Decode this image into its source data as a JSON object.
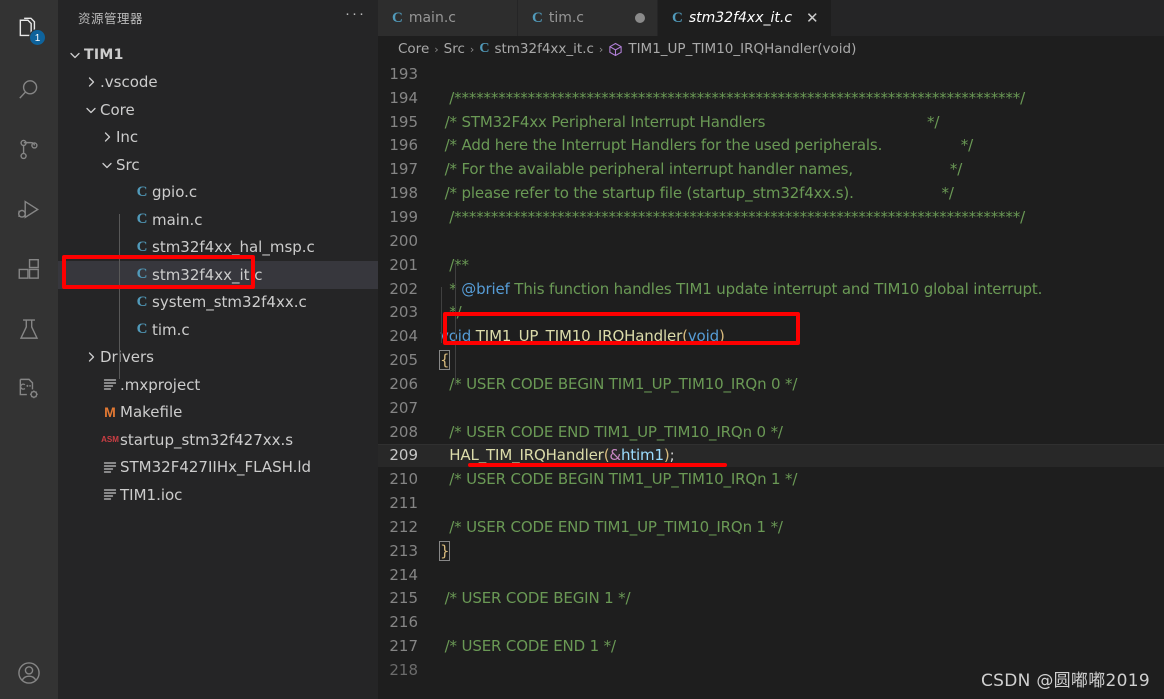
{
  "activity_bar": {
    "items": [
      {
        "name": "explorer",
        "icon": "files-icon",
        "active": true,
        "badge": "1"
      },
      {
        "name": "search",
        "icon": "search-icon",
        "active": false,
        "badge": ""
      },
      {
        "name": "source-control",
        "icon": "source-control-icon",
        "active": false,
        "badge": ""
      },
      {
        "name": "run-and-debug",
        "icon": "run-debug-icon",
        "active": false,
        "badge": ""
      },
      {
        "name": "extensions",
        "icon": "extensions-icon",
        "active": false,
        "badge": ""
      },
      {
        "name": "testing",
        "icon": "flask-icon",
        "active": false,
        "badge": ""
      },
      {
        "name": "cpp-config",
        "icon": "cpp-gear-icon",
        "active": false,
        "badge": ""
      }
    ],
    "bottom": [
      {
        "name": "accounts",
        "icon": "account-icon"
      }
    ]
  },
  "sidebar": {
    "title": "资源管理器",
    "more_actions": "···",
    "tree": [
      {
        "label": "TIM1",
        "depth": 0,
        "kind": "folder-root",
        "twisty": "down",
        "icon": "",
        "selected": false
      },
      {
        "label": ".vscode",
        "depth": 1,
        "kind": "folder",
        "twisty": "right",
        "icon": "",
        "selected": false
      },
      {
        "label": "Core",
        "depth": 1,
        "kind": "folder",
        "twisty": "down",
        "icon": "",
        "selected": false
      },
      {
        "label": "Inc",
        "depth": 2,
        "kind": "folder",
        "twisty": "right",
        "icon": "",
        "selected": false
      },
      {
        "label": "Src",
        "depth": 2,
        "kind": "folder",
        "twisty": "down",
        "icon": "",
        "selected": false
      },
      {
        "label": "gpio.c",
        "depth": 3,
        "kind": "file",
        "twisty": "none",
        "icon": "c-file-icon",
        "selected": false
      },
      {
        "label": "main.c",
        "depth": 3,
        "kind": "file",
        "twisty": "none",
        "icon": "c-file-icon",
        "selected": false
      },
      {
        "label": "stm32f4xx_hal_msp.c",
        "depth": 3,
        "kind": "file",
        "twisty": "none",
        "icon": "c-file-icon",
        "selected": false
      },
      {
        "label": "stm32f4xx_it.c",
        "depth": 3,
        "kind": "file",
        "twisty": "none",
        "icon": "c-file-icon",
        "selected": true
      },
      {
        "label": "system_stm32f4xx.c",
        "depth": 3,
        "kind": "file",
        "twisty": "none",
        "icon": "c-file-icon",
        "selected": false
      },
      {
        "label": "tim.c",
        "depth": 3,
        "kind": "file",
        "twisty": "none",
        "icon": "c-file-icon",
        "selected": false
      },
      {
        "label": "Drivers",
        "depth": 1,
        "kind": "folder",
        "twisty": "right",
        "icon": "",
        "selected": false
      },
      {
        "label": ".mxproject",
        "depth": 1,
        "kind": "file",
        "twisty": "none",
        "icon": "text-file-icon",
        "selected": false
      },
      {
        "label": "Makefile",
        "depth": 1,
        "kind": "file",
        "twisty": "none",
        "icon": "makefile-icon",
        "selected": false
      },
      {
        "label": "startup_stm32f427xx.s",
        "depth": 1,
        "kind": "file",
        "twisty": "none",
        "icon": "asm-file-icon",
        "selected": false
      },
      {
        "label": "STM32F427IIHx_FLASH.ld",
        "depth": 1,
        "kind": "file",
        "twisty": "none",
        "icon": "text-file-icon",
        "selected": false
      },
      {
        "label": "TIM1.ioc",
        "depth": 1,
        "kind": "file",
        "twisty": "none",
        "icon": "text-file-icon",
        "selected": false
      }
    ]
  },
  "tabs": [
    {
      "label": "main.c",
      "icon": "c-file-icon",
      "active": false,
      "dirty": false,
      "closable": false
    },
    {
      "label": "tim.c",
      "icon": "c-file-icon",
      "active": false,
      "dirty": true,
      "closable": false
    },
    {
      "label": "stm32f4xx_it.c",
      "icon": "c-file-icon",
      "active": true,
      "dirty": false,
      "closable": true
    }
  ],
  "breadcrumb": {
    "parts": [
      "Core",
      "Src",
      "stm32f4xx_it.c",
      "TIM1_UP_TIM10_IRQHandler(void)"
    ],
    "separator": "›",
    "file_icon": "c-file-icon",
    "symbol_icon": "symbol-method-icon"
  },
  "editor": {
    "active_line": 209,
    "first_line": 193,
    "last_line": 218,
    "lines": [
      {
        "n": 193,
        "tokens": []
      },
      {
        "n": 194,
        "tokens": [
          {
            "t": "  /*****************************************************************************/",
            "c": "cmt"
          }
        ]
      },
      {
        "n": 195,
        "tokens": [
          {
            "t": " /* STM32F4xx Peripheral Interrupt Handlers                                   */",
            "c": "cmt"
          }
        ]
      },
      {
        "n": 196,
        "tokens": [
          {
            "t": " /* Add here the Interrupt Handlers for the used peripherals.                 */",
            "c": "cmt"
          }
        ]
      },
      {
        "n": 197,
        "tokens": [
          {
            "t": " /* For the available peripheral interrupt handler names,                     */",
            "c": "cmt"
          }
        ]
      },
      {
        "n": 198,
        "tokens": [
          {
            "t": " /* please refer to the startup file (startup_stm32f4xx.s).                   */",
            "c": "cmt"
          }
        ]
      },
      {
        "n": 199,
        "tokens": [
          {
            "t": "  /*****************************************************************************/",
            "c": "cmt"
          }
        ]
      },
      {
        "n": 200,
        "tokens": []
      },
      {
        "n": 201,
        "tokens": [
          {
            "t": "  /**",
            "c": "cmt"
          }
        ]
      },
      {
        "n": 202,
        "tokens": [
          {
            "t": "  * ",
            "c": "cmt"
          },
          {
            "t": "@brief",
            "c": "doctag"
          },
          {
            "t": " This function handles TIM1 update interrupt and TIM10 global interrupt.",
            "c": "cmt"
          }
        ]
      },
      {
        "n": 203,
        "tokens": [
          {
            "t": "  */",
            "c": "cmt"
          }
        ]
      },
      {
        "n": 204,
        "tokens": [
          {
            "t": "void",
            "c": "kw"
          },
          {
            "t": " ",
            "c": "punc"
          },
          {
            "t": "TIM1_UP_TIM10_IRQHandler",
            "c": "fn"
          },
          {
            "t": "(",
            "c": "par"
          },
          {
            "t": "void",
            "c": "kw"
          },
          {
            "t": ")",
            "c": "par"
          }
        ]
      },
      {
        "n": 205,
        "tokens": [
          {
            "t": "{",
            "c": "brace-hl"
          }
        ]
      },
      {
        "n": 206,
        "tokens": [
          {
            "t": "  /* USER CODE BEGIN TIM1_UP_TIM10_IRQn 0 */",
            "c": "cmt"
          }
        ]
      },
      {
        "n": 207,
        "tokens": []
      },
      {
        "n": 208,
        "tokens": [
          {
            "t": "  /* USER CODE END TIM1_UP_TIM10_IRQn 0 */",
            "c": "cmt"
          }
        ]
      },
      {
        "n": 209,
        "tokens": [
          {
            "t": "  ",
            "c": "punc"
          },
          {
            "t": "HAL_TIM_IRQHandler",
            "c": "fn"
          },
          {
            "t": "(",
            "c": "par"
          },
          {
            "t": "&",
            "c": "op"
          },
          {
            "t": "htim1",
            "c": "var"
          },
          {
            "t": ")",
            "c": "par"
          },
          {
            "t": ";",
            "c": "punc"
          }
        ]
      },
      {
        "n": 210,
        "tokens": [
          {
            "t": "  /* USER CODE BEGIN TIM1_UP_TIM10_IRQn 1 */",
            "c": "cmt"
          }
        ]
      },
      {
        "n": 211,
        "tokens": []
      },
      {
        "n": 212,
        "tokens": [
          {
            "t": "  /* USER CODE END TIM1_UP_TIM10_IRQn 1 */",
            "c": "cmt"
          }
        ]
      },
      {
        "n": 213,
        "tokens": [
          {
            "t": "}",
            "c": "brace-hl"
          }
        ]
      },
      {
        "n": 214,
        "tokens": []
      },
      {
        "n": 215,
        "tokens": [
          {
            "t": " /* USER CODE BEGIN 1 */",
            "c": "cmt"
          }
        ]
      },
      {
        "n": 216,
        "tokens": []
      },
      {
        "n": 217,
        "tokens": [
          {
            "t": " /* USER CODE END 1 */",
            "c": "cmt"
          }
        ]
      },
      {
        "n": 218,
        "tokens": []
      }
    ]
  },
  "annotations": {
    "color": "#fe0000",
    "file_box": {
      "target": "sidebar stm32f4xx_it.c"
    },
    "signature_box": {
      "target": "line 204 void TIM1_UP_TIM10_IRQHandler(void)"
    },
    "call_underline": {
      "target": "line 209 HAL_TIM_IRQHandler(&htim1);"
    }
  },
  "watermark": "CSDN @圆嘟嘟2019",
  "colors": {
    "activity_bar_bg": "#333333",
    "sidebar_bg": "#252526",
    "editor_bg": "#1e1e1e",
    "tab_inactive_bg": "#2d2d2d",
    "tab_active_bg": "#1e1e1e",
    "selection_bg": "#37373d",
    "badge_bg": "#0e639c",
    "comment": "#6a9955",
    "keyword": "#569cd6",
    "function": "#dcdcaa",
    "variable": "#9cdcfe",
    "annotation_red": "#fe0000"
  }
}
